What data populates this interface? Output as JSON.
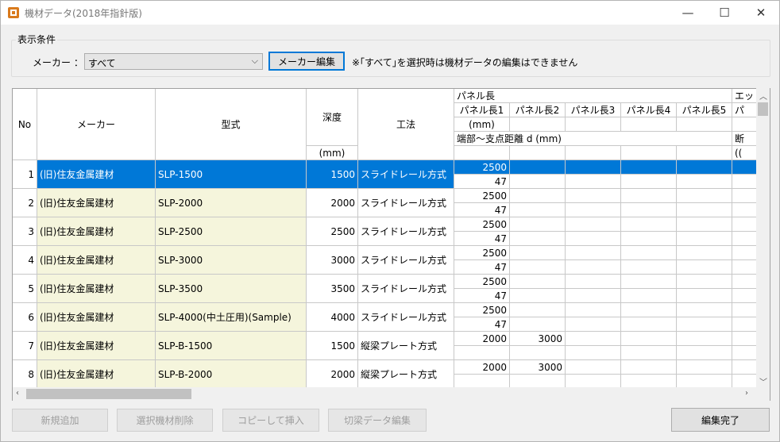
{
  "window": {
    "title": "機材データ(2018年指針版)",
    "min_glyph": "—",
    "max_glyph": "☐",
    "close_glyph": "✕"
  },
  "filter": {
    "group_label": "表示条件",
    "maker_label": "メーカー ：",
    "maker_value": "すべて",
    "maker_edit_button": "メーカー編集",
    "notice": "※｢すべて｣を選択時は機材データの編集はできません"
  },
  "grid": {
    "headers": {
      "no": "No",
      "maker": "メーカー",
      "model": "型式",
      "depth": "深度",
      "depth_unit": "(mm)",
      "method": "工法",
      "panel_length": "パネル長",
      "panel_cols": [
        "パネル長1",
        "パネル長2",
        "パネル長3",
        "パネル長4",
        "パネル長5"
      ],
      "panel_unit": "(mm)",
      "support_distance": "端部～支点距離 d (mm)",
      "extra_top": "エッ",
      "extra_sub": "パ",
      "extra_mid": "断",
      "extra_unit": "(("
    },
    "rows": [
      {
        "no": "1",
        "maker": "(旧)住友金属建材",
        "model": "SLP-1500",
        "depth": "1500",
        "method": "スライドレール方式",
        "p1": "2500",
        "p2": "",
        "d": "47"
      },
      {
        "no": "2",
        "maker": "(旧)住友金属建材",
        "model": "SLP-2000",
        "depth": "2000",
        "method": "スライドレール方式",
        "p1": "2500",
        "p2": "",
        "d": "47"
      },
      {
        "no": "3",
        "maker": "(旧)住友金属建材",
        "model": "SLP-2500",
        "depth": "2500",
        "method": "スライドレール方式",
        "p1": "2500",
        "p2": "",
        "d": "47"
      },
      {
        "no": "4",
        "maker": "(旧)住友金属建材",
        "model": "SLP-3000",
        "depth": "3000",
        "method": "スライドレール方式",
        "p1": "2500",
        "p2": "",
        "d": "47"
      },
      {
        "no": "5",
        "maker": "(旧)住友金属建材",
        "model": "SLP-3500",
        "depth": "3500",
        "method": "スライドレール方式",
        "p1": "2500",
        "p2": "",
        "d": "47"
      },
      {
        "no": "6",
        "maker": "(旧)住友金属建材",
        "model": "SLP-4000(中土圧用)(Sample)",
        "depth": "4000",
        "method": "スライドレール方式",
        "p1": "2500",
        "p2": "",
        "d": "47"
      },
      {
        "no": "7",
        "maker": "(旧)住友金属建材",
        "model": "SLP-B-1500",
        "depth": "1500",
        "method": "縦梁プレート方式",
        "p1": "2000",
        "p2": "3000",
        "d": ""
      },
      {
        "no": "8",
        "maker": "(旧)住友金属建材",
        "model": "SLP-B-2000",
        "depth": "2000",
        "method": "縦梁プレート方式",
        "p1": "2000",
        "p2": "3000",
        "d": ""
      }
    ]
  },
  "buttons": {
    "add_new": "新規追加",
    "delete_selected": "選択機材削除",
    "copy_insert": "コピーして挿入",
    "cut_beam_edit": "切梁データ編集",
    "finish_edit": "編集完了"
  },
  "colors": {
    "selection": "#0078d7",
    "cream": "#f5f5dc"
  }
}
